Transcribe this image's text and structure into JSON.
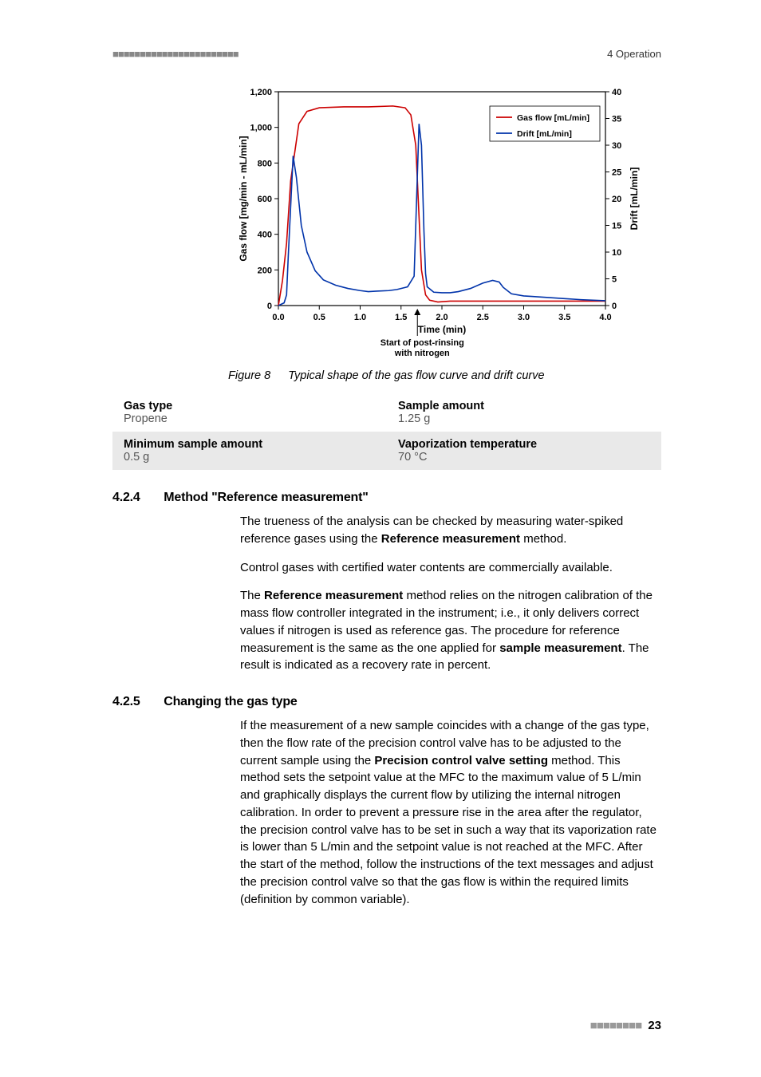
{
  "header": {
    "left_dots": "■■■■■■■■■■■■■■■■■■■■■■■",
    "right": "4 Operation"
  },
  "chart_data": {
    "type": "line",
    "title": "",
    "xlabel": "Time (min)",
    "ylabel_left": "Gas flow [mg/min - mL/min]",
    "ylabel_right": "Drift [mL/min]",
    "xlim": [
      0.0,
      4.0
    ],
    "ylim_left": [
      0,
      1200
    ],
    "ylim_right": [
      0,
      40
    ],
    "xticks": [
      "0.0",
      "0.5",
      "1.0",
      "1.5",
      "2.0",
      "2.5",
      "3.0",
      "3.5",
      "4.0"
    ],
    "yticks_left": [
      0,
      200,
      400,
      600,
      800,
      1000,
      1200
    ],
    "yticks_right": [
      0,
      5,
      10,
      15,
      20,
      25,
      30,
      35,
      40
    ],
    "legend": [
      "Gas flow [mL/min]",
      "Drift [mL/min]"
    ],
    "annotation": "Start of post-rinsing with nitrogen",
    "annotation_x": 1.7,
    "series": [
      {
        "name": "Gas flow [mL/min]",
        "axis": "left",
        "color": "#cc0000",
        "x": [
          0.0,
          0.05,
          0.1,
          0.15,
          0.25,
          0.35,
          0.5,
          0.8,
          1.1,
          1.4,
          1.55,
          1.62,
          1.68,
          1.72,
          1.75,
          1.8,
          1.85,
          1.95,
          2.1,
          2.6,
          2.7,
          2.8,
          3.1,
          3.4,
          4.0
        ],
        "values": [
          0,
          140,
          350,
          700,
          1020,
          1090,
          1110,
          1115,
          1115,
          1120,
          1110,
          1070,
          900,
          500,
          200,
          60,
          30,
          20,
          25,
          25,
          25,
          25,
          25,
          25,
          25
        ]
      },
      {
        "name": "Drift [mL/min]",
        "axis": "right",
        "color": "#0033aa",
        "x": [
          0.0,
          0.07,
          0.1,
          0.12,
          0.18,
          0.22,
          0.28,
          0.35,
          0.45,
          0.55,
          0.7,
          0.85,
          1.0,
          1.1,
          1.2,
          1.35,
          1.45,
          1.58,
          1.66,
          1.68,
          1.72,
          1.75,
          1.78,
          1.8,
          1.82,
          1.9,
          2.0,
          2.1,
          2.2,
          2.35,
          2.5,
          2.62,
          2.7,
          2.75,
          2.85,
          3.0,
          3.1,
          3.3,
          3.5,
          3.7,
          4.0
        ],
        "values": [
          0,
          0.5,
          2.0,
          9.0,
          28.0,
          24.0,
          15.0,
          10.0,
          6.5,
          4.8,
          3.8,
          3.2,
          2.8,
          2.6,
          2.7,
          2.8,
          3.0,
          3.5,
          5.5,
          15.0,
          34.0,
          30.0,
          14.0,
          6.0,
          3.5,
          2.5,
          2.4,
          2.4,
          2.6,
          3.2,
          4.2,
          4.7,
          4.4,
          3.4,
          2.2,
          1.8,
          1.7,
          1.5,
          1.3,
          1.1,
          0.9
        ]
      }
    ]
  },
  "figure": {
    "label": "Figure 8",
    "caption": "Typical shape of the gas flow curve and drift curve"
  },
  "info": {
    "gas_type": {
      "label": "Gas type",
      "value": "Propene"
    },
    "sample_amount": {
      "label": "Sample amount",
      "value": "1.25 g"
    },
    "min_sample": {
      "label": "Minimum sample amount",
      "value": "0.5 g"
    },
    "vap_temp": {
      "label": "Vaporization temperature",
      "value": "70 °C"
    }
  },
  "s424": {
    "num": "4.2.4",
    "title": "Method \"Reference measurement\"",
    "p1a": "The trueness of the analysis can be checked by measuring water-spiked reference gases using the ",
    "p1b": "Reference measurement",
    "p1c": " method.",
    "p2": "Control gases with certified water contents are commercially available.",
    "p3a": "The ",
    "p3b": "Reference measurement",
    "p3c": " method relies on the nitrogen calibration of the mass flow controller integrated in the instrument; i.e., it only delivers correct values if nitrogen is used as reference gas. The procedure for reference measurement is the same as the one applied for ",
    "p3d": "sample measurement",
    "p3e": ". The result is indicated as a recovery rate in percent."
  },
  "s425": {
    "num": "4.2.5",
    "title": "Changing the gas type",
    "p1a": "If the measurement of a new sample coincides with a change of the gas type, then the flow rate of the precision control valve has to be adjusted to the current sample using the ",
    "p1b": "Precision control valve setting",
    "p1c": " method. This method sets the setpoint value at the MFC to the maximum value of 5 L/min and graphically displays the current flow by utilizing the internal nitrogen calibration. In order to prevent a pressure rise in the area after the regulator, the precision control valve has to be set in such a way that its vaporization rate is lower than 5 L/min and the setpoint value is not reached at the MFC. After the start of the method, follow the instructions of the text messages and adjust the precision control valve so that the gas flow is within the required limits (definition by common variable)."
  },
  "footer": {
    "dots": "■■■■■■■■",
    "page": "23"
  }
}
